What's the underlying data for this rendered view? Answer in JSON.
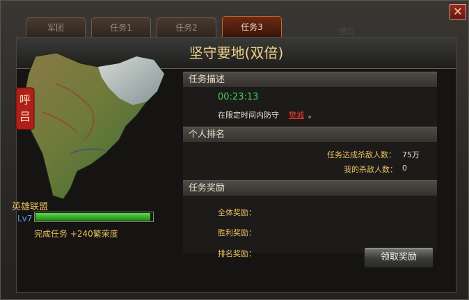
{
  "window": {
    "close_glyph": "✕",
    "bg_text": "港口"
  },
  "tabs": [
    {
      "label": "军团",
      "active": false
    },
    {
      "label": "任务1",
      "active": false
    },
    {
      "label": "任务2",
      "active": false
    },
    {
      "label": "任务3",
      "active": true
    }
  ],
  "title": "坚守要地(双倍)",
  "map": {
    "seal_text": "呼吕"
  },
  "alliance": {
    "name": "英雄联盟",
    "level": "Lv7",
    "exp_progress": 0.98,
    "complete_text": "完成任务 +240繁荣度"
  },
  "task_desc": {
    "heading": "任务描述",
    "timer": "00:23:13",
    "desc_prefix": "在限定时间内防守",
    "city": "樊城",
    "desc_suffix": "。"
  },
  "ranking": {
    "heading": "个人排名",
    "total_kills_label": "任务达成杀敌人数：",
    "total_kills_value": "75万",
    "my_kills_label": "我的杀敌人数：",
    "my_kills_value": "0"
  },
  "rewards": {
    "heading": "任务奖励",
    "all_label": "全体奖励：",
    "win_label": "胜利奖励：",
    "rank_label": "排名奖励：",
    "claim_button": "领取奖励"
  },
  "colors": {
    "accent_gold": "#e8c060",
    "timer_green": "#3ed25a",
    "city_red": "#e83a2a"
  }
}
